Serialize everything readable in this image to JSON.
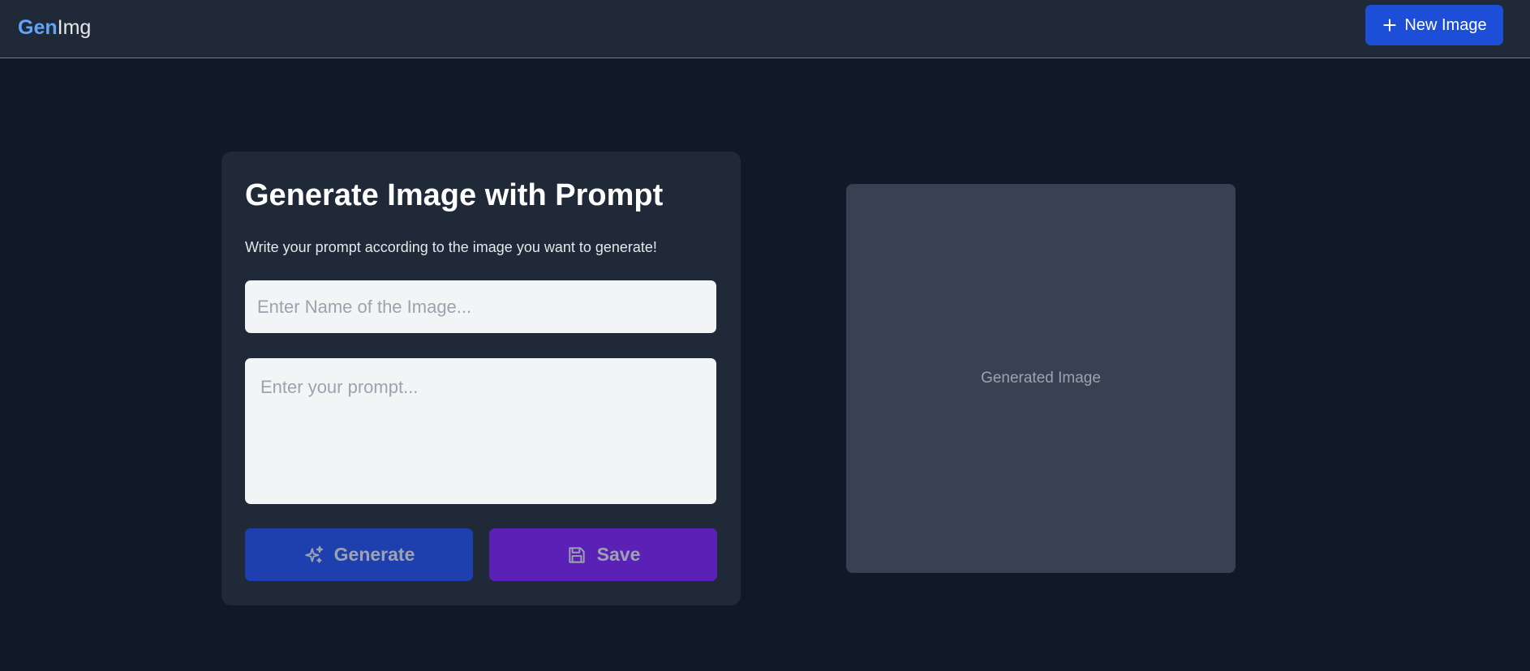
{
  "header": {
    "logo_part1": "Gen",
    "logo_part2": "Img",
    "new_image_label": "New Image",
    "new_image_icon": "plus-icon"
  },
  "form": {
    "title": "Generate Image with Prompt",
    "subtitle": "Write your prompt according to the image you want to generate!",
    "name_value": "",
    "name_placeholder": "Enter Name of the Image...",
    "prompt_value": "",
    "prompt_placeholder": "Enter your prompt...",
    "generate_label": "Generate",
    "generate_icon": "sparkles-icon",
    "save_label": "Save",
    "save_icon": "floppy-disk-icon"
  },
  "preview": {
    "placeholder_text": "Generated Image"
  },
  "colors": {
    "background": "#111827",
    "panel": "#1f2937",
    "accent_blue": "#1d4ed8",
    "logo_blue": "#60a5fa",
    "generate_button": "#1e40af",
    "save_button": "#5b21b6",
    "preview_box": "#374151"
  }
}
